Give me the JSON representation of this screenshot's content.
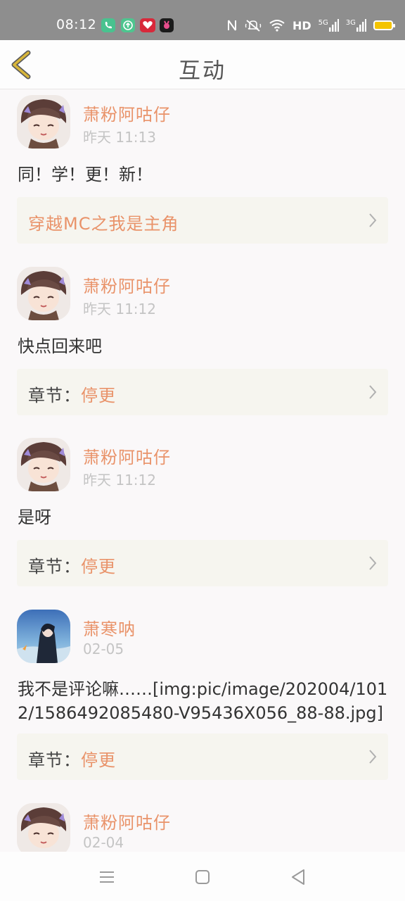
{
  "status_bar": {
    "time": "08:12",
    "network_hd": "HD",
    "signal_1": "5G",
    "signal_2": "3G",
    "colors": {
      "background": "#8e8e8e",
      "battery": "#f4c400"
    },
    "apps": [
      "phone-app-icon",
      "upload-app-icon",
      "red-app-icon",
      "dark-app-icon"
    ],
    "icons": [
      "nfc-icon",
      "mute-icon",
      "wifi-icon",
      "battery-icon"
    ]
  },
  "header": {
    "title": "互动",
    "back_icon": "chevron-left-icon",
    "accent": "#d8b63a"
  },
  "feed": {
    "accent_color": "#e9936a",
    "items": [
      {
        "user": "萧粉阿咕仔",
        "time": "昨天 11:13",
        "comment": "同！学！更！新！",
        "ref_prefix": "",
        "ref_value": "穿越MC之我是主角",
        "avatar": "anime-girl-avatar"
      },
      {
        "user": "萧粉阿咕仔",
        "time": "昨天 11:12",
        "comment": "快点回来吧",
        "ref_prefix": "章节：",
        "ref_value": "停更",
        "avatar": "anime-girl-avatar"
      },
      {
        "user": "萧粉阿咕仔",
        "time": "昨天 11:12",
        "comment": "是呀",
        "ref_prefix": "章节：",
        "ref_value": "停更",
        "avatar": "anime-girl-avatar"
      },
      {
        "user": "萧寒呐",
        "time": "02-05",
        "comment": "我不是评论嘛……[img:pic/image/202004/1012/1586492085480-V95436X056_88-88.jpg]",
        "ref_prefix": "章节：",
        "ref_value": "停更",
        "avatar": "anime-boy-blue-avatar"
      },
      {
        "user": "萧粉阿咕仔",
        "time": "02-04",
        "avatar": "anime-girl-avatar"
      }
    ]
  },
  "nav_bar": {
    "icons": [
      "menu-icon",
      "home-icon",
      "back-icon"
    ]
  }
}
